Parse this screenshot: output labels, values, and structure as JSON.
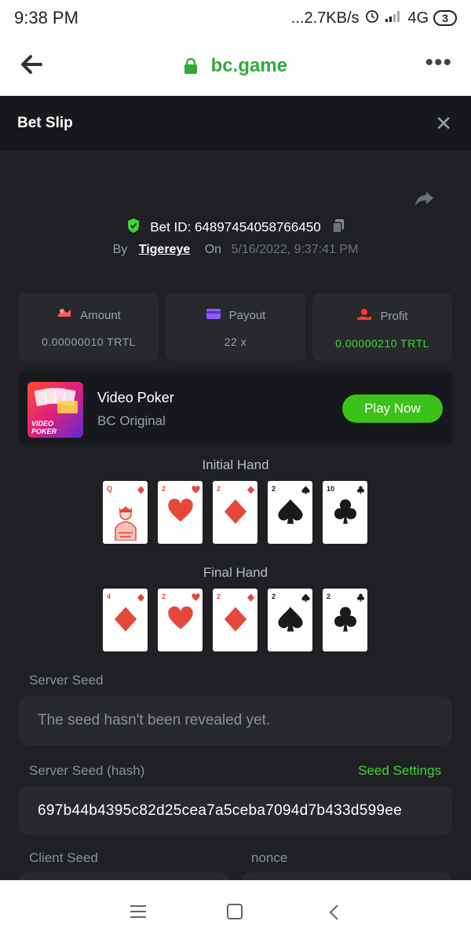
{
  "status_bar": {
    "time": "9:38 PM",
    "net_speed": "...2.7KB/s",
    "network": "4G",
    "battery": "3"
  },
  "browser": {
    "url": "bc.game",
    "icons": [
      "back-arrow-icon",
      "lock-icon",
      "more-dots-icon"
    ]
  },
  "sheet": {
    "title": "Bet Slip",
    "close_icon": "close-icon"
  },
  "bet": {
    "id_label": "Bet ID: 64897454058766450",
    "by_label": "By",
    "user": "Tigereye",
    "on_label": "On",
    "date": "5/16/2022, 9:37:41 PM"
  },
  "stats": [
    {
      "label": "Amount",
      "value": "0.00000010 TRTL",
      "icon": "amount-icon",
      "color": "#ff5a5a"
    },
    {
      "label": "Payout",
      "value": "22 x",
      "icon": "payout-card-icon",
      "color": "#8b5cf6"
    },
    {
      "label": "Profit",
      "value": "0.00000210 TRTL",
      "icon": "profit-icon",
      "color": "#ff3b30"
    }
  ],
  "game": {
    "name": "Video Poker",
    "subtitle": "BC Original",
    "thumb_text": "VIDEO POKER",
    "play_label": "Play Now"
  },
  "initial_hand": {
    "label": "Initial Hand",
    "cards": [
      {
        "rank": "Q",
        "suit": "diamond"
      },
      {
        "rank": "2",
        "suit": "heart"
      },
      {
        "rank": "2",
        "suit": "diamond"
      },
      {
        "rank": "2",
        "suit": "spade"
      },
      {
        "rank": "10",
        "suit": "club"
      }
    ]
  },
  "final_hand": {
    "label": "Final Hand",
    "cards": [
      {
        "rank": "4",
        "suit": "diamond"
      },
      {
        "rank": "2",
        "suit": "heart"
      },
      {
        "rank": "2",
        "suit": "diamond"
      },
      {
        "rank": "2",
        "suit": "spade"
      },
      {
        "rank": "2",
        "suit": "club"
      }
    ]
  },
  "seeds": {
    "server_seed_label": "Server Seed",
    "server_seed_placeholder": "The seed hasn't been revealed yet.",
    "server_hash_label": "Server Seed (hash)",
    "seed_settings_label": "Seed Settings",
    "server_hash_value": "697b44b4395c82d25cea7a5ceba7094d7b433d599ee",
    "client_seed_label": "Client Seed",
    "nonce_label": "nonce"
  },
  "colors": {
    "accent_green": "#3bc117",
    "profit_green": "#3fd435",
    "background": "#1e2023",
    "card_red": "#e5483b"
  }
}
